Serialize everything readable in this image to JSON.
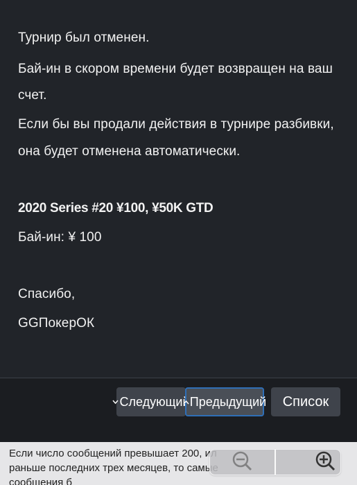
{
  "message": {
    "lines": [
      "Турнир был отменен.",
      "Бай-ин в скором времени будет возвращен на ваш",
      "счет.",
      "Если бы вы продали действия в турнире разбивки,",
      "она будет отменена автоматически."
    ],
    "tournament_name": "2020 Series #20 ¥100, ¥50K GTD",
    "buyin": "Бай-ин: ¥ 100",
    "thanks": "Спасибо,",
    "signature": "GGПокерОК"
  },
  "footer": {
    "next_label": "Следующий",
    "prev_label": "Предыдущий",
    "list_label": "Список"
  },
  "notice": {
    "line1": "Если число сообщений превышает 200, ил",
    "line2": "раньше последних трех месяцев, то самые",
    "line3": "сообщения б"
  },
  "icons": {
    "next_icon": "chevron-down-icon",
    "prev_icon": "chevron-up-icon",
    "zoom_out": "zoom-out-icon",
    "zoom_in": "zoom-in-icon"
  }
}
